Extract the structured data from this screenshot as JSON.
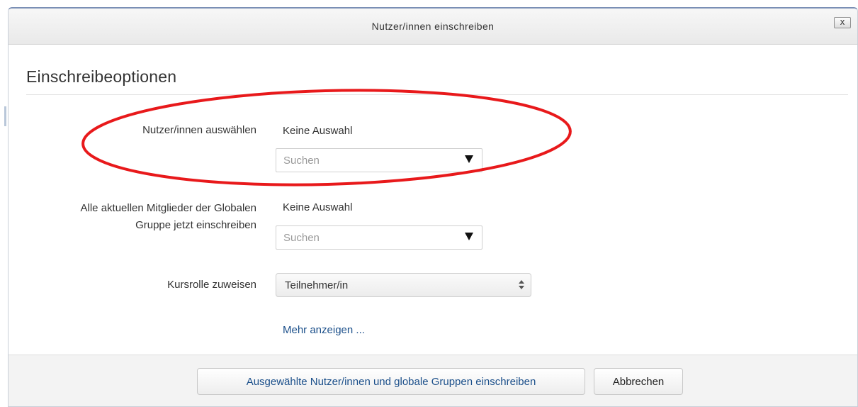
{
  "dialog": {
    "title": "Nutzer/innen einschreiben",
    "close_label": "x"
  },
  "section": {
    "title": "Einschreibeoptionen"
  },
  "form": {
    "select_users": {
      "label": "Nutzer/innen auswählen",
      "selection": "Keine Auswahl",
      "search_placeholder": "Suchen"
    },
    "global_groups": {
      "label_line1": "Alle aktuellen Mitglieder der Globalen",
      "label_line2": "Gruppe jetzt einschreiben",
      "selection": "Keine Auswahl",
      "search_placeholder": "Suchen"
    },
    "course_role": {
      "label": "Kursrolle zuweisen",
      "value": "Teilnehmer/in"
    },
    "more_link": "Mehr anzeigen ..."
  },
  "footer": {
    "enrol_button": "Ausgewählte Nutzer/innen und globale Gruppen einschreiben",
    "cancel_button": "Abbrechen"
  },
  "colors": {
    "annotation_ellipse": "#e8191b",
    "link": "#1b4f8a"
  },
  "icons": {
    "close": "close-icon",
    "dropdown": "triangle-down-icon",
    "select": "updown-icon"
  }
}
